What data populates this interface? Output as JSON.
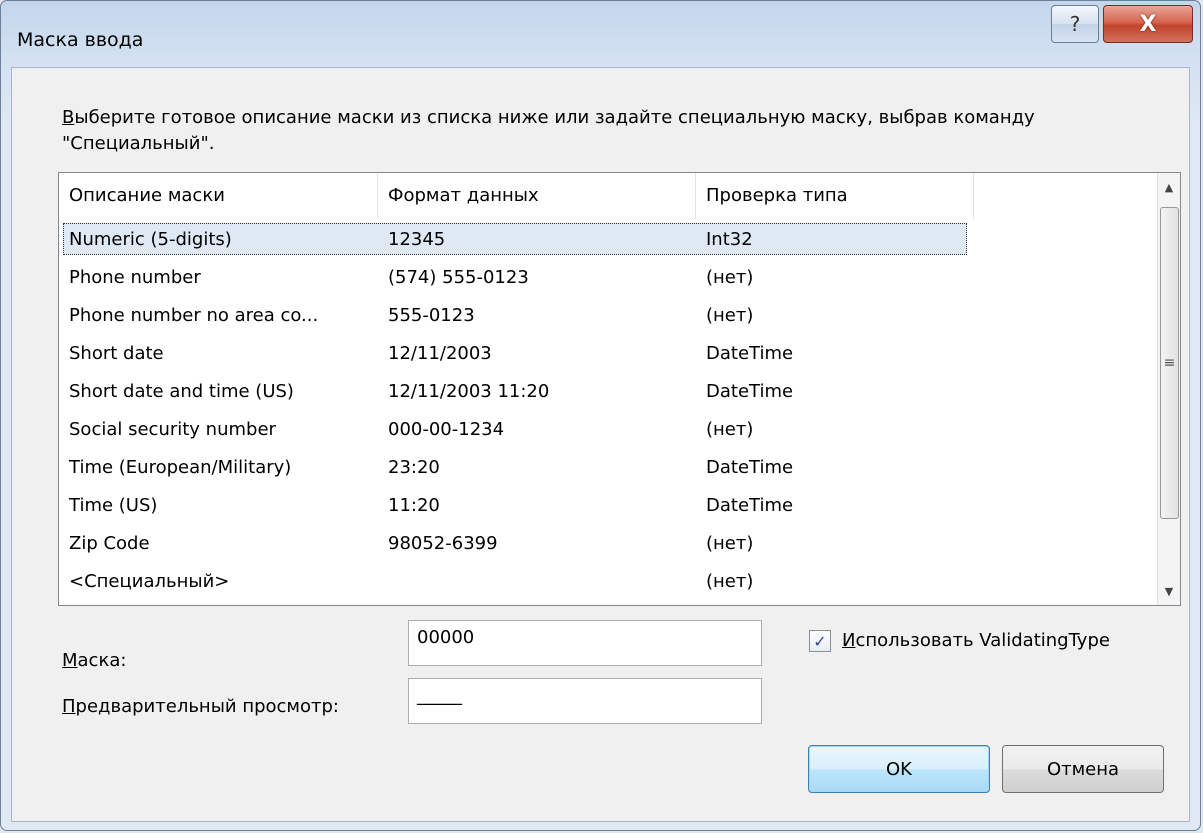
{
  "window": {
    "title": "Маска ввода",
    "help_glyph": "?",
    "close_glyph": "X"
  },
  "instructions": {
    "first_letter": "В",
    "rest": "ыберите готовое описание маски из списка ниже или задайте специальную маску, выбрав команду \"Специальный\"."
  },
  "list": {
    "columns": [
      "Описание маски",
      "Формат данных",
      "Проверка типа"
    ],
    "rows": [
      {
        "description": "Numeric (5-digits)",
        "format": "12345",
        "type": "Int32",
        "selected": true
      },
      {
        "description": "Phone number",
        "format": "(574) 555-0123",
        "type": "(нет)"
      },
      {
        "description": "Phone number no area co...",
        "format": "555-0123",
        "type": "(нет)"
      },
      {
        "description": "Short date",
        "format": "12/11/2003",
        "type": "DateTime"
      },
      {
        "description": "Short date and time (US)",
        "format": "12/11/2003 11:20",
        "type": "DateTime"
      },
      {
        "description": "Social security number",
        "format": "000-00-1234",
        "type": "(нет)"
      },
      {
        "description": "Time (European/Military)",
        "format": "23:20",
        "type": "DateTime"
      },
      {
        "description": "Time (US)",
        "format": "11:20",
        "type": "DateTime"
      },
      {
        "description": "Zip Code",
        "format": "98052-6399",
        "type": "(нет)"
      },
      {
        "description": "<Специальный>",
        "format": "",
        "type": "(нет)"
      }
    ]
  },
  "mask": {
    "label_first": "М",
    "label_rest": "аска:",
    "value": "00000"
  },
  "preview": {
    "label_first": "П",
    "label_rest": "редварительный просмотр:",
    "value": "_____"
  },
  "validating": {
    "label_first": "И",
    "label_rest": "спользовать ValidatingType",
    "checked": true
  },
  "buttons": {
    "ok": "OK",
    "cancel": "Отмена"
  }
}
